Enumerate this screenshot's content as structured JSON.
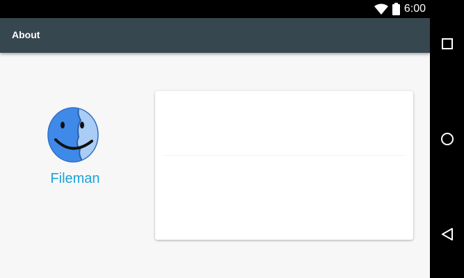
{
  "status_bar": {
    "time": "6:00",
    "icons": [
      "wifi-icon",
      "battery-icon"
    ]
  },
  "app_bar": {
    "title": "About"
  },
  "app": {
    "name": "Fileman",
    "logo_icon": "finder-face-logo"
  },
  "nav_bar": {
    "buttons": [
      "recents-square-icon",
      "home-circle-icon",
      "back-triangle-icon"
    ]
  },
  "colors": {
    "app_bar": "#37474f",
    "accent": "#1aa3d9",
    "background": "#f7f7f7",
    "card": "#ffffff"
  }
}
